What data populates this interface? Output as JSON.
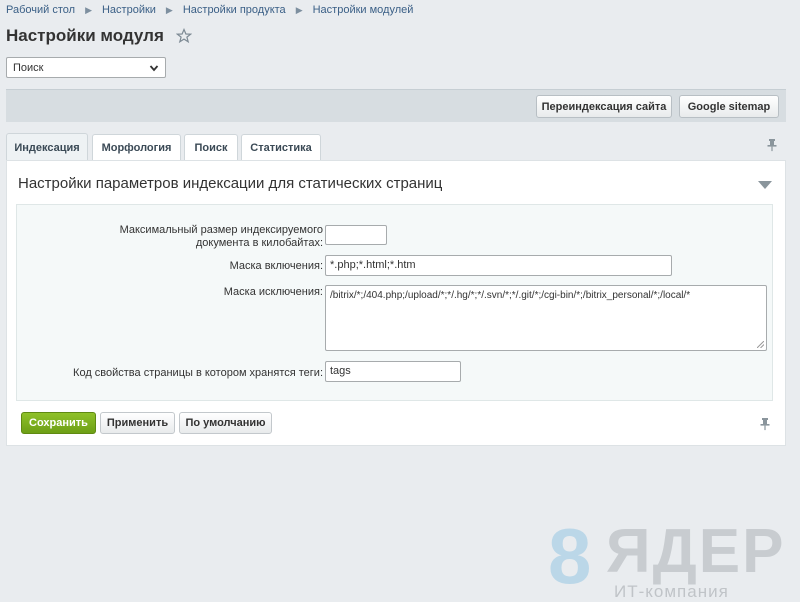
{
  "breadcrumb": [
    "Рабочий стол",
    "Настройки",
    "Настройки продукта",
    "Настройки модулей"
  ],
  "page": {
    "title": "Настройки модуля"
  },
  "module_select": {
    "value": "Поиск"
  },
  "toolbar": {
    "reindex_label": "Переиндексация сайта",
    "sitemap_label": "Google sitemap"
  },
  "tabs": [
    {
      "label": "Индексация",
      "active": true
    },
    {
      "label": "Морфология",
      "active": false
    },
    {
      "label": "Поиск",
      "active": false
    },
    {
      "label": "Статистика",
      "active": false
    }
  ],
  "section": {
    "title": "Настройки параметров индексации для статических страниц",
    "fields": {
      "max_size": {
        "label": "Максимальный размер индексируемого документа в килобайтах:",
        "value": ""
      },
      "include_mask": {
        "label": "Маска включения:",
        "value": "*.php;*.html;*.htm"
      },
      "exclude_mask": {
        "label": "Маска исключения:",
        "value": "/bitrix/*;/404.php;/upload/*;*/.hg/*;*/.svn/*;*/.git/*;/cgi-bin/*;/bitrix_personal/*;/local/*"
      },
      "tags_property": {
        "label": "Код свойства страницы в котором хранятся теги:",
        "value": "tags"
      }
    }
  },
  "actions": {
    "save_label": "Сохранить",
    "apply_label": "Применить",
    "default_label": "По умолчанию"
  },
  "watermark": {
    "digit": "8",
    "brand": "ЯДЕР",
    "subtitle": "ИТ-компания"
  },
  "icons": {
    "favorite": "star-icon",
    "collapse": "triangle-down-icon",
    "pin": "pin-icon",
    "select": "chevron-down-icon"
  },
  "colors": {
    "save_button": "#7aad1c",
    "link": "#3a5f86",
    "toolbar": "#d7dde1"
  }
}
